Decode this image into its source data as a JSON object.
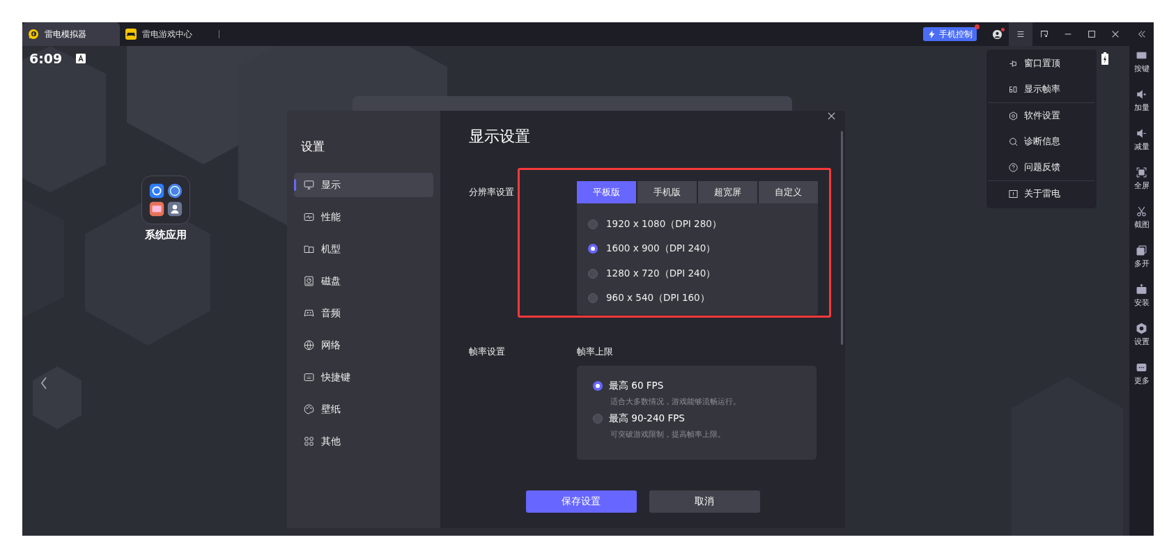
{
  "title_bar": {
    "tabs": [
      {
        "label": "雷电模拟器",
        "selected": true
      },
      {
        "label": "雷电游戏中心",
        "selected": false
      }
    ],
    "phone_control": {
      "label": "手机控制",
      "notification": true
    },
    "account_notification": true,
    "menu_open": true
  },
  "status_bar": {
    "time": "6:09"
  },
  "desktop": {
    "folder": {
      "label": "系统应用"
    }
  },
  "dropdown_menu": {
    "sections": [
      {
        "items": [
          {
            "label": "窗口置顶"
          },
          {
            "label": "显示帧率"
          }
        ]
      },
      {
        "items": [
          {
            "label": "软件设置"
          },
          {
            "label": "诊断信息"
          },
          {
            "label": "问题反馈"
          }
        ]
      },
      {
        "items": [
          {
            "label": "关于雷电"
          }
        ]
      }
    ]
  },
  "right_sidebar": [
    "按键",
    "加量",
    "减量",
    "全屏",
    "截图",
    "多开",
    "安装",
    "设置",
    "更多"
  ],
  "settings_dialog": {
    "title": "设置",
    "nav": [
      {
        "label": "显示",
        "selected": true
      },
      {
        "label": "性能",
        "selected": false
      },
      {
        "label": "机型",
        "selected": false
      },
      {
        "label": "磁盘",
        "selected": false
      },
      {
        "label": "音频",
        "selected": false
      },
      {
        "label": "网络",
        "selected": false
      },
      {
        "label": "快捷键",
        "selected": false
      },
      {
        "label": "壁纸",
        "selected": false
      },
      {
        "label": "其他",
        "selected": false
      }
    ],
    "heading": "显示设置",
    "resolution": {
      "label": "分辨率设置",
      "highlighted": true,
      "tabs": [
        {
          "label": "平板版",
          "selected": true
        },
        {
          "label": "手机版",
          "selected": false
        },
        {
          "label": "超宽屏",
          "selected": false
        },
        {
          "label": "自定义",
          "selected": false
        }
      ],
      "options": [
        {
          "label": "1920 x 1080（DPI 280）",
          "selected": false
        },
        {
          "label": "1600 x 900（DPI 240）",
          "selected": true
        },
        {
          "label": "1280 x 720（DPI 240）",
          "selected": false
        },
        {
          "label": "960 x 540（DPI 160）",
          "selected": false
        }
      ]
    },
    "frame_rate": {
      "label": "帧率设置",
      "sublabel": "帧率上限",
      "options": [
        {
          "label": "最高 60 FPS",
          "description": "适合大多数情况，游戏能够流畅运行。",
          "selected": true
        },
        {
          "label": "最高 90-240 FPS",
          "description": "可突破游戏限制，提高帧率上限。",
          "selected": false
        }
      ]
    },
    "buttons": [
      {
        "label": "保存设置",
        "kind": "primary"
      },
      {
        "label": "取消",
        "kind": "secondary"
      }
    ]
  }
}
